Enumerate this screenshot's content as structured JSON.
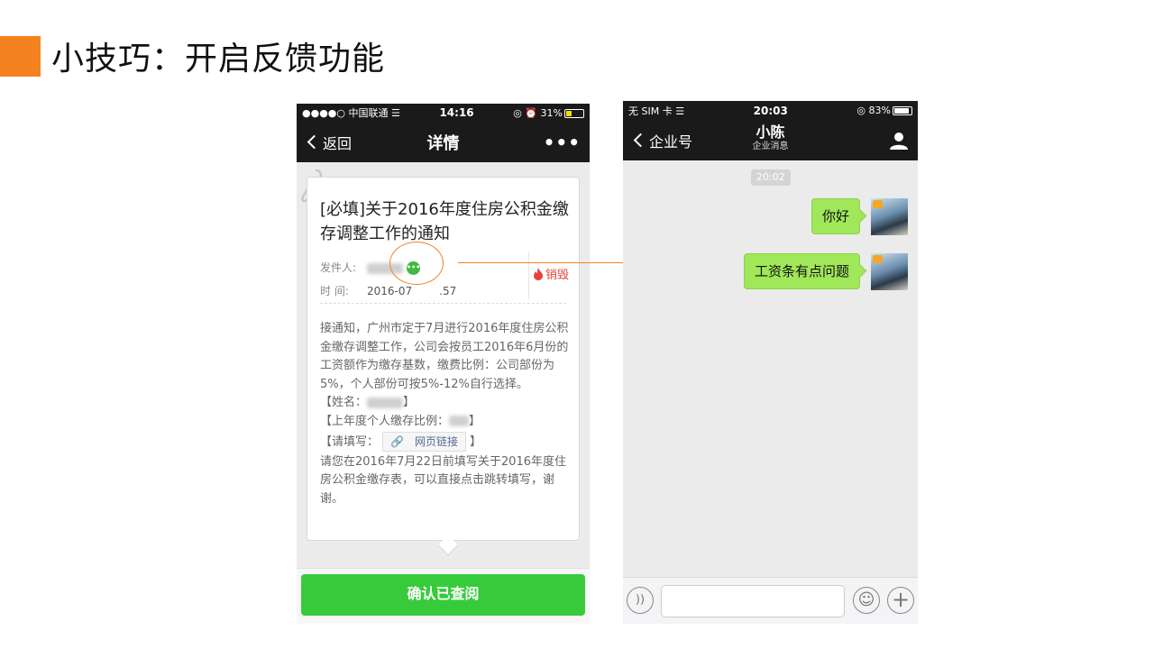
{
  "slide": {
    "title": "小技巧：开启反馈功能",
    "accent_color": "#f58220"
  },
  "phone_left": {
    "status": {
      "carrier": "●●●●○ 中国联通",
      "time": "14:16",
      "battery": "31%"
    },
    "nav": {
      "back_label": "返回",
      "title": "详情",
      "more_label": "•••"
    },
    "notice": {
      "title": "[必填]关于2016年度住房公积金缴存调整工作的通知",
      "sender_label": "发件人:",
      "time_label": "时    间:",
      "time_value": "2016-07",
      "time_value_tail": ".57",
      "destroy_label": "销毁",
      "body": [
        "接通知，广州市定于7月进行2016年度住房公积金缴存调整工作，公司会按员工2016年6月份的工资额作为缴存基数，缴费比例：公司部份为5%，个人部份可按5%-12%自行选择。"
      ],
      "name_field_label": "【姓名：",
      "name_field_end": "】",
      "ratio_field_label": "【上年度个人缴存比例：",
      "ratio_field_end": "】",
      "fill_label": "【请填写：",
      "fill_end": "】",
      "link_label": "网页链接",
      "footer_text": "请您在2016年7月22日前填写关于2016年度住房公积金缴存表，可以直接点击跳转填写，谢谢。"
    },
    "confirm_label": "确认已查阅",
    "confirm_color": "#37cb3b"
  },
  "phone_right": {
    "status": {
      "carrier": "无 SIM 卡",
      "time": "20:03",
      "battery": "83%"
    },
    "nav": {
      "back_label": "企业号",
      "title": "小陈",
      "subtitle": "企业消息"
    },
    "chat": {
      "timestamp": "20:02",
      "messages": [
        {
          "text": "你好"
        },
        {
          "text": "工资条有点问题"
        }
      ]
    },
    "bubble_color": "#a0e75a"
  }
}
